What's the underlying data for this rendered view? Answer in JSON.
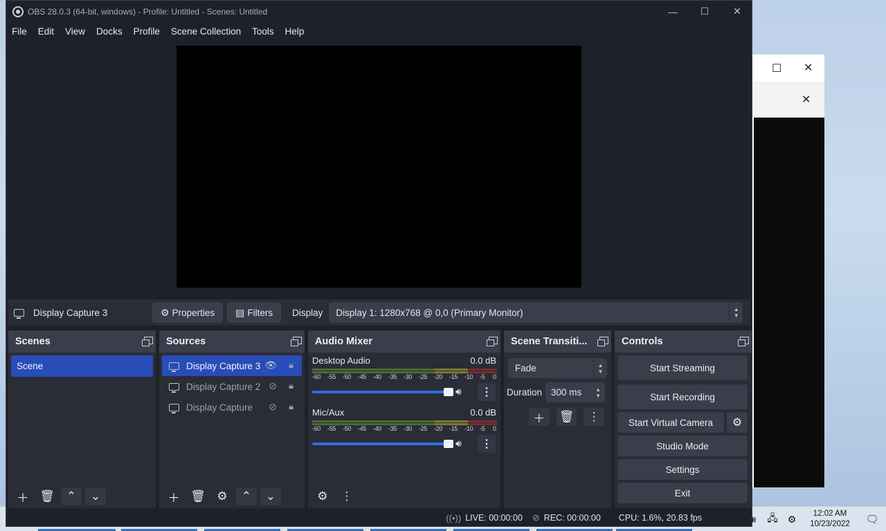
{
  "window": {
    "title": "OBS 28.0.3 (64-bit, windows) - Profile: Untitled - Scenes: Untitled",
    "minimize_glyph": "—",
    "maximize_glyph": "☐",
    "close_glyph": "✕"
  },
  "menu": [
    "File",
    "Edit",
    "View",
    "Docks",
    "Profile",
    "Scene Collection",
    "Tools",
    "Help"
  ],
  "context_bar": {
    "source_name": "Display Capture 3",
    "properties_label": "Properties",
    "filters_label": "Filters",
    "display_label": "Display",
    "display_value": "Display 1: 1280x768 @ 0,0 (Primary Monitor)"
  },
  "scenes": {
    "title": "Scenes",
    "items": [
      "Scene"
    ]
  },
  "sources": {
    "title": "Sources",
    "items": [
      {
        "name": "Display Capture 3",
        "visible": true
      },
      {
        "name": "Display Capture 2",
        "visible": false
      },
      {
        "name": "Display Capture",
        "visible": false
      }
    ]
  },
  "audio_mixer": {
    "title": "Audio Mixer",
    "channels": [
      {
        "name": "Desktop Audio",
        "level": "0.0 dB",
        "volume": 1.0
      },
      {
        "name": "Mic/Aux",
        "level": "0.0 dB",
        "volume": 1.0
      }
    ],
    "ticks": [
      "-60",
      "-55",
      "-50",
      "-45",
      "-40",
      "-35",
      "-30",
      "-25",
      "-20",
      "-15",
      "-10",
      "-5",
      "0"
    ]
  },
  "transitions": {
    "title": "Scene Transiti...",
    "selected": "Fade",
    "duration_label": "Duration",
    "duration_value": "300 ms"
  },
  "controls": {
    "title": "Controls",
    "start_streaming": "Start Streaming",
    "start_recording": "Start Recording",
    "start_virtual_camera": "Start Virtual Camera",
    "studio_mode": "Studio Mode",
    "settings": "Settings",
    "exit": "Exit"
  },
  "status": {
    "live": "LIVE: 00:00:00",
    "rec": "REC: 00:00:00",
    "cpu": "CPU: 1.6%, 20.83 fps"
  },
  "taskbar": {
    "time": "12:02 AM",
    "date": "10/23/2022"
  },
  "colors": {
    "accent": "#284cb8",
    "panel": "#2a2c36",
    "header": "#3a3d4a",
    "window_bg": "#1f212a"
  }
}
